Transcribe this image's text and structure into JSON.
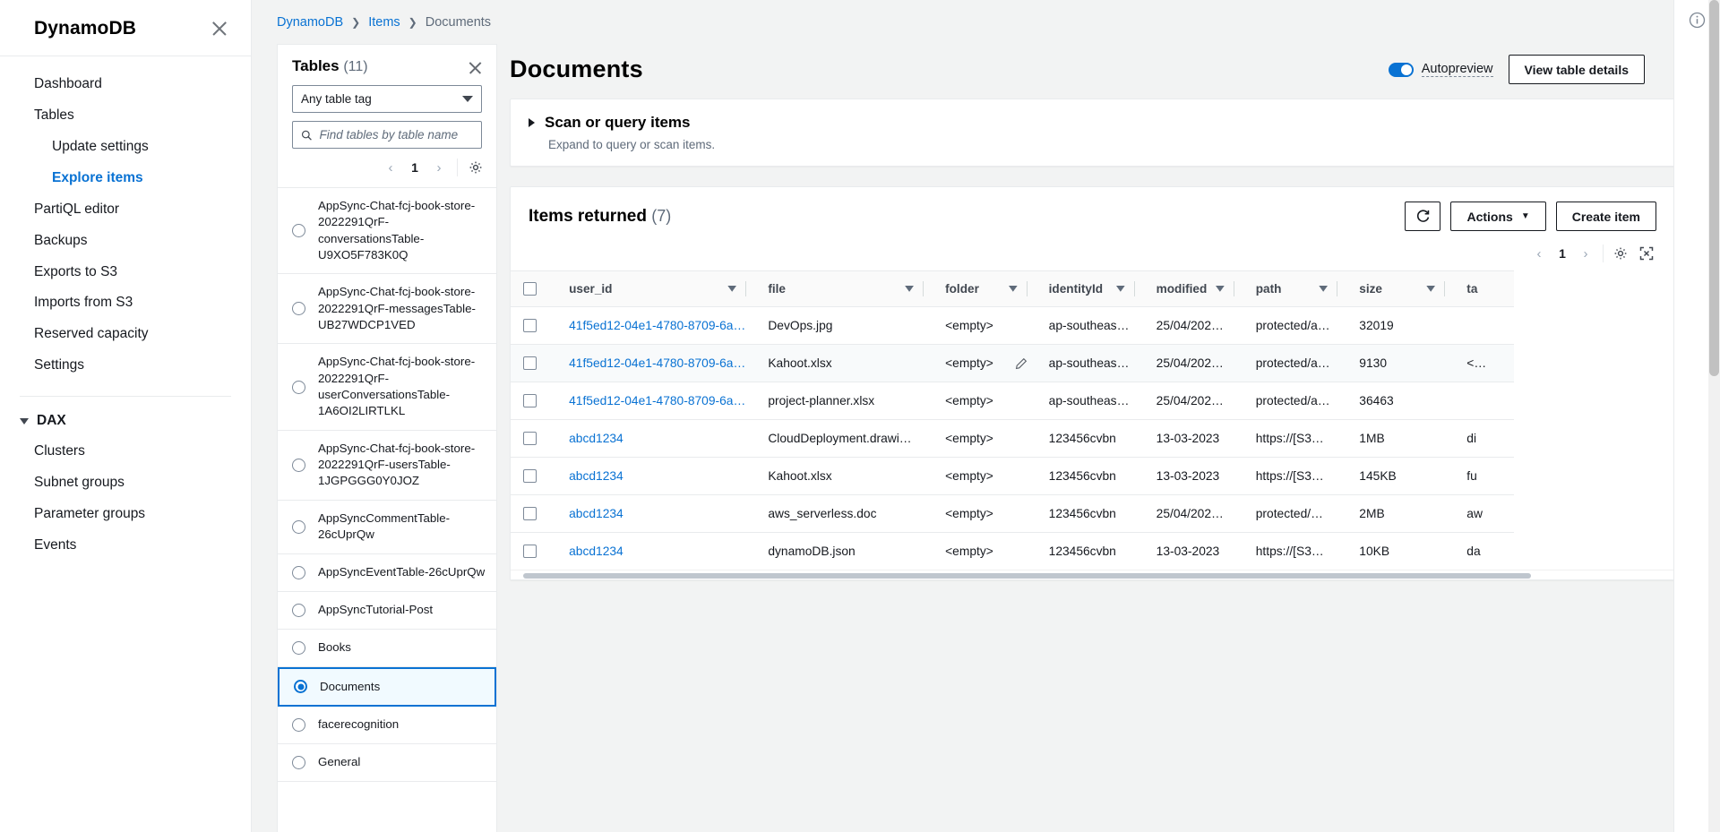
{
  "sidebar": {
    "title": "DynamoDB",
    "close_icon": "close-icon",
    "items": [
      {
        "label": "Dashboard",
        "sub": false,
        "active": false
      },
      {
        "label": "Tables",
        "sub": false,
        "active": false
      },
      {
        "label": "Update settings",
        "sub": true,
        "active": false
      },
      {
        "label": "Explore items",
        "sub": true,
        "active": true
      },
      {
        "label": "PartiQL editor",
        "sub": false,
        "active": false
      },
      {
        "label": "Backups",
        "sub": false,
        "active": false
      },
      {
        "label": "Exports to S3",
        "sub": false,
        "active": false
      },
      {
        "label": "Imports from S3",
        "sub": false,
        "active": false
      },
      {
        "label": "Reserved capacity",
        "sub": false,
        "active": false
      },
      {
        "label": "Settings",
        "sub": false,
        "active": false
      }
    ],
    "group": {
      "label": "DAX",
      "items": [
        {
          "label": "Clusters"
        },
        {
          "label": "Subnet groups"
        },
        {
          "label": "Parameter groups"
        },
        {
          "label": "Events"
        }
      ]
    }
  },
  "breadcrumb": {
    "items": [
      "DynamoDB",
      "Items"
    ],
    "current": "Documents",
    "separator": "❯"
  },
  "tables_panel": {
    "title": "Tables",
    "count": "(11)",
    "close_icon": "close-icon",
    "tag_filter": {
      "value": "Any table tag"
    },
    "search": {
      "placeholder": "Find tables by table name",
      "value": "",
      "icon": "search-icon"
    },
    "pager": {
      "prev": "‹",
      "page": "1",
      "next": "›",
      "settings_icon": "gear-icon"
    },
    "rows": [
      {
        "name": "AppSync-Chat-fcj-book-store-2022291QrF-conversationsTable-U9XO5F783K0Q",
        "selected": false
      },
      {
        "name": "AppSync-Chat-fcj-book-store-2022291QrF-messagesTable-UB27WDCP1VED",
        "selected": false
      },
      {
        "name": "AppSync-Chat-fcj-book-store-2022291QrF-userConversationsTable-1A6OI2LIRTLKL",
        "selected": false
      },
      {
        "name": "AppSync-Chat-fcj-book-store-2022291QrF-usersTable-1JGPGGG0Y0JOZ",
        "selected": false
      },
      {
        "name": "AppSyncCommentTable-26cUprQw",
        "selected": false
      },
      {
        "name": "AppSyncEventTable-26cUprQw",
        "selected": false
      },
      {
        "name": "AppSyncTutorial-Post",
        "selected": false
      },
      {
        "name": "Books",
        "selected": false
      },
      {
        "name": "Documents",
        "selected": true
      },
      {
        "name": "facerecognition",
        "selected": false
      },
      {
        "name": "General",
        "selected": false
      }
    ]
  },
  "page": {
    "title": "Documents",
    "autopreview_label": "Autopreview",
    "autopreview_on": true,
    "view_table_details": "View table details"
  },
  "scan_section": {
    "title": "Scan or query items",
    "subtitle": "Expand to query or scan items.",
    "expanded": false,
    "caret_icon": "caret-right-icon"
  },
  "items_section": {
    "title": "Items returned",
    "count": "(7)",
    "refresh_icon": "refresh-icon",
    "actions_label": "Actions",
    "actions_caret": "▼",
    "create_label": "Create item",
    "pager": {
      "prev": "‹",
      "page": "1",
      "next": "›",
      "settings_icon": "gear-icon",
      "fullscreen_icon": "fullscreen-icon"
    },
    "columns": [
      {
        "key": "user_id",
        "label": "user_id"
      },
      {
        "key": "file",
        "label": "file"
      },
      {
        "key": "folder",
        "label": "folder"
      },
      {
        "key": "identityId",
        "label": "identityId"
      },
      {
        "key": "modified",
        "label": "modified"
      },
      {
        "key": "path",
        "label": "path"
      },
      {
        "key": "size",
        "label": "size"
      },
      {
        "key": "tag",
        "label": "ta"
      }
    ],
    "rows": [
      {
        "user_id": "41f5ed12-04e1-4780-8709-6a…",
        "file": "DevOps.jpg",
        "folder": "<empty>",
        "identityId": "ap-southeas…",
        "modified": "25/04/202…",
        "path": "protected/a…",
        "size": "32019",
        "tag": ""
      },
      {
        "user_id": "41f5ed12-04e1-4780-8709-6a…",
        "file": "Kahoot.xlsx",
        "folder": "<empty>",
        "identityId": "ap-southeas…",
        "modified": "25/04/202…",
        "path": "protected/a…",
        "size": "9130",
        "tag": "<…",
        "highlight": true,
        "folder_editable": true
      },
      {
        "user_id": "41f5ed12-04e1-4780-8709-6a…",
        "file": "project-planner.xlsx",
        "folder": "<empty>",
        "identityId": "ap-southeas…",
        "modified": "25/04/202…",
        "path": "protected/a…",
        "size": "36463",
        "tag": ""
      },
      {
        "user_id": "abcd1234",
        "file": "CloudDeployment.drawi…",
        "folder": "<empty>",
        "identityId": "123456cvbn",
        "modified": "13-03-2023",
        "path": "https://[S3…",
        "size": "1MB",
        "tag": "di"
      },
      {
        "user_id": "abcd1234",
        "file": "Kahoot.xlsx",
        "folder": "<empty>",
        "identityId": "123456cvbn",
        "modified": "13-03-2023",
        "path": "https://[S3…",
        "size": "145KB",
        "tag": "fu"
      },
      {
        "user_id": "abcd1234",
        "file": "aws_serverless.doc",
        "folder": "<empty>",
        "identityId": "123456cvbn",
        "modified": "25/04/202…",
        "path": "protected/…",
        "size": "2MB",
        "tag": "aw"
      },
      {
        "user_id": "abcd1234",
        "file": "dynamoDB.json",
        "folder": "<empty>",
        "identityId": "123456cvbn",
        "modified": "13-03-2023",
        "path": "https://[S3…",
        "size": "10KB",
        "tag": "da"
      }
    ]
  },
  "right_rail": {
    "info_icon": "info-icon"
  },
  "colors": {
    "accent": "#0972d3",
    "text": "#16191f",
    "muted": "#5f6b7a",
    "bg": "#f2f3f3",
    "border": "#e9ebed"
  }
}
